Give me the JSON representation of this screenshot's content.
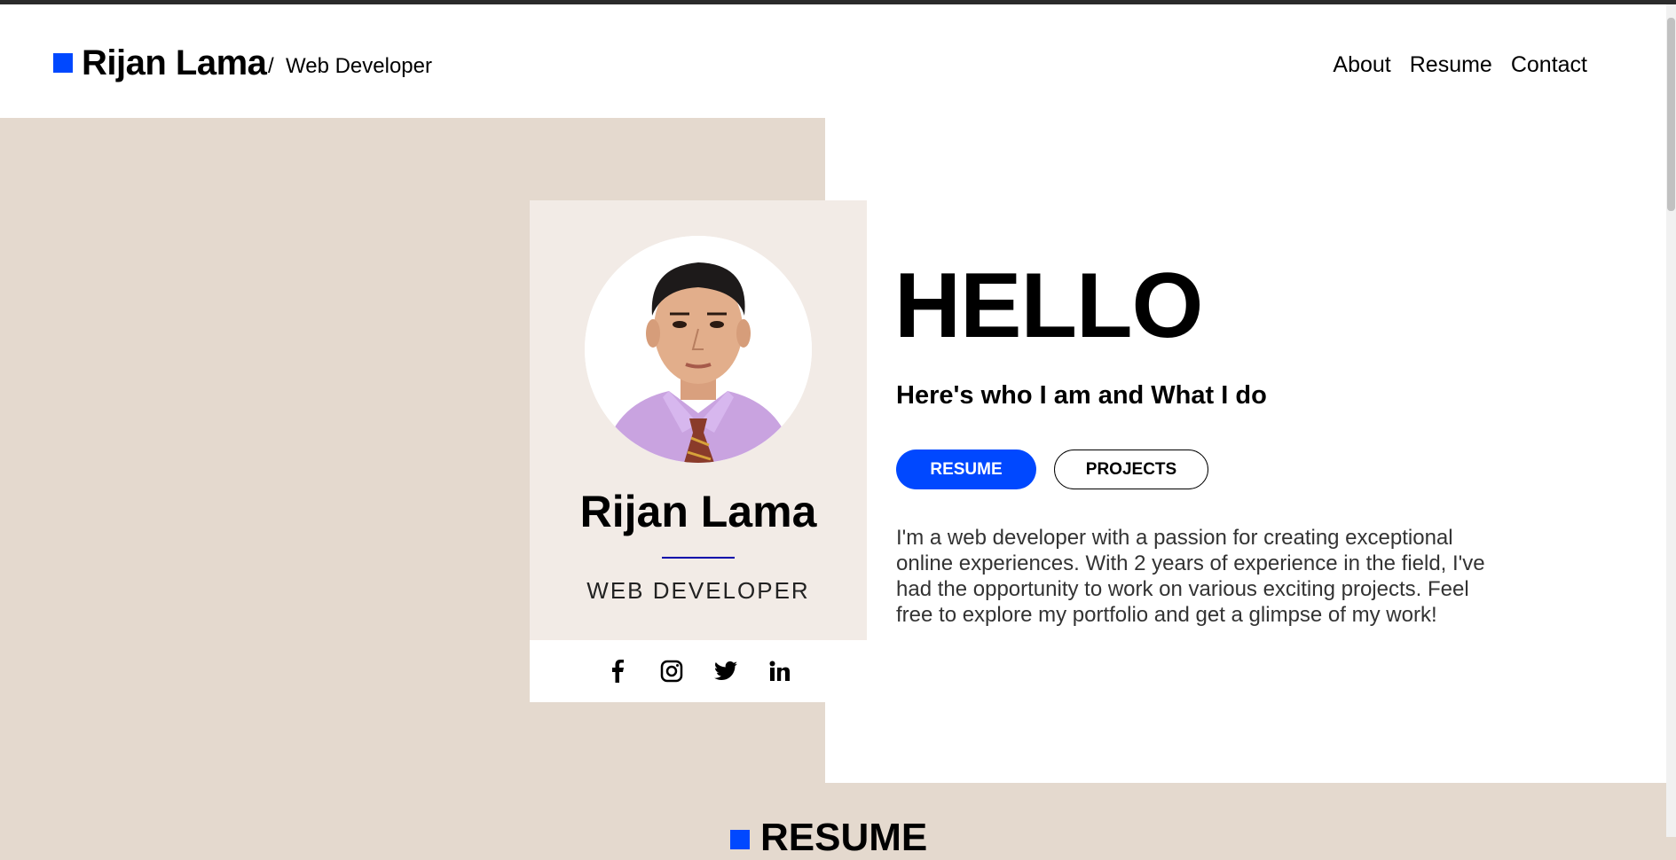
{
  "header": {
    "brand_name": "Rijan Lama",
    "separator": "/",
    "brand_role": "Web Developer",
    "nav": [
      "About",
      "Resume",
      "Contact"
    ]
  },
  "card": {
    "name": "Rijan Lama",
    "role": "WEB DEVELOPER",
    "social_icons": [
      "facebook-icon",
      "instagram-icon",
      "twitter-icon",
      "linkedin-icon"
    ]
  },
  "hero": {
    "greeting": "HELLO",
    "subtitle": "Here's who I am and What I do",
    "resume_button": "RESUME",
    "projects_button": "PROJECTS",
    "bio": "I'm a web developer with a passion for creating exceptional online experiences. With 2 years of experience in the field, I've had the opportunity to work on various exciting projects. Feel free to explore my portfolio and get a glimpse of my work!"
  },
  "next_section": {
    "title": "RESUME"
  },
  "colors": {
    "accent": "#0048ff",
    "beige": "#e4d9ce",
    "card_bg": "#f2ebe6"
  }
}
